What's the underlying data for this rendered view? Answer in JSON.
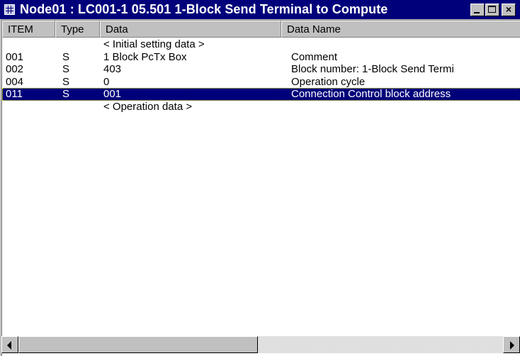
{
  "window": {
    "title": "Node01 : LC001-1 05.501 1-Block Send Terminal to Compute",
    "controls": {
      "minimize": "minimize",
      "maximize": "maximize",
      "close": "×"
    }
  },
  "table": {
    "columns": [
      "ITEM",
      "Type",
      "Data",
      "Data Name"
    ],
    "rows": [
      {
        "item": "",
        "type": "",
        "data": "< Initial setting data >",
        "name": ""
      },
      {
        "item": "001",
        "type": "S",
        "data": "1 Block PcTx Box",
        "name": "Comment"
      },
      {
        "item": "002",
        "type": "S",
        "data": "403",
        "name": "Block number: 1-Block Send Termi"
      },
      {
        "item": "004",
        "type": "S",
        "data": "0",
        "name": "Operation cycle"
      },
      {
        "item": "011",
        "type": "S",
        "data": "001",
        "name": "Connection Control block address",
        "selected": true
      },
      {
        "item": "",
        "type": "",
        "data": "< Operation data >",
        "name": ""
      }
    ]
  },
  "colors": {
    "title_bar": "#00007b",
    "selection": "#00007b",
    "face": "#c0c0c0"
  }
}
